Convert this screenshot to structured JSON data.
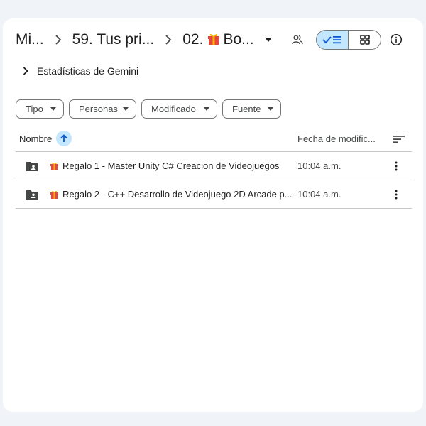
{
  "breadcrumbs": [
    {
      "label": "Mi..."
    },
    {
      "label": "59. Tus pri..."
    },
    {
      "label": "02.",
      "suffix": "Bo...",
      "has_gift_icon": true
    }
  ],
  "icons": {
    "separator": "chevron-right-icon",
    "caret": "caret-down-icon",
    "share": "people-icon",
    "list_view": "check-list-icon",
    "grid_view": "grid-icon",
    "info": "info-icon",
    "sort": "sort-lines-icon",
    "more": "more-vert-icon",
    "folder": "shared-folder-icon",
    "gift": "gift-icon"
  },
  "gemini": {
    "label": "Estadísticas de Gemini"
  },
  "filters": [
    {
      "label": "Tipo"
    },
    {
      "label": "Personas"
    },
    {
      "label": "Modificado"
    },
    {
      "label": "Fuente"
    }
  ],
  "table": {
    "columns": {
      "name": "Nombre",
      "date": "Fecha de modific..."
    },
    "sort_direction": "ascending",
    "rows": [
      {
        "name": "Regalo 1 - Master Unity C# Creacion de Videojuegos",
        "date": "10:04 a.m."
      },
      {
        "name": "Regalo 2 - C++ Desarrollo de Videojuego 2D Arcade p...",
        "date": "10:04 a.m."
      }
    ]
  },
  "colors": {
    "page_bg": "#f0f4f9",
    "surface": "#ffffff",
    "accent_selected": "#c2e7ff",
    "accent_icon": "#0b57d0",
    "border": "#747775",
    "divider": "#c7c7c7",
    "gift_red": "#e2483d",
    "gift_gold": "#f5b400"
  }
}
